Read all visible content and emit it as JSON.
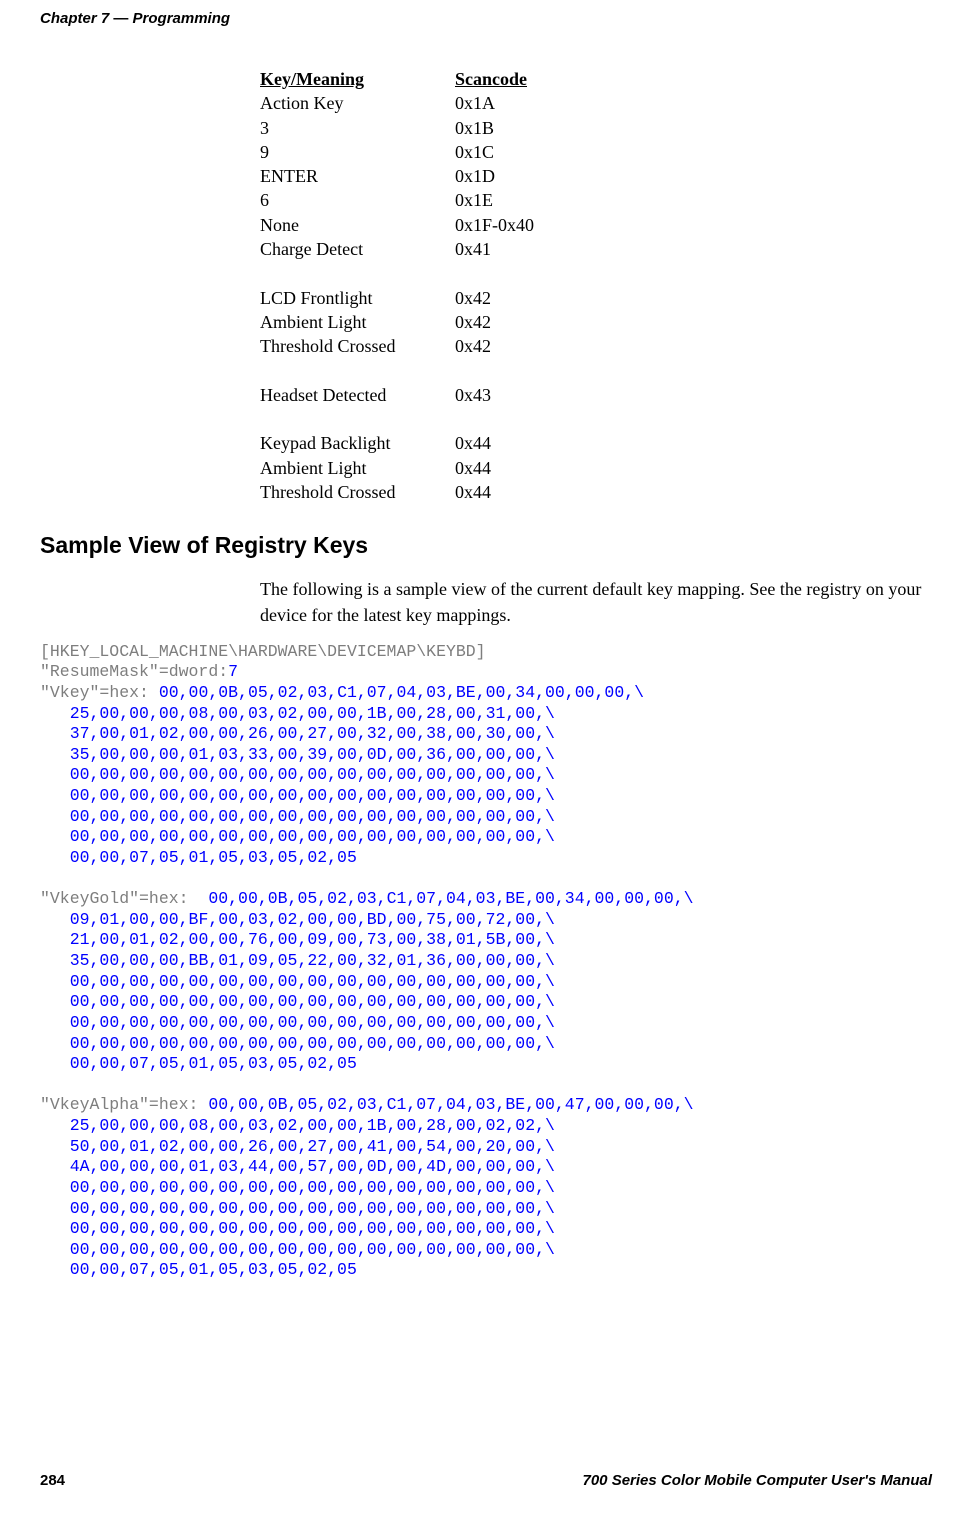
{
  "header": {
    "chapter": "Chapter 7",
    "sep": "—",
    "title": "Programming"
  },
  "scancode_table": {
    "head": {
      "key": "Key/Meaning",
      "scan": "Scancode"
    },
    "group1": [
      {
        "key": "Action Key",
        "scan": "0x1A"
      },
      {
        "key": "3",
        "scan": "0x1B"
      },
      {
        "key": "9",
        "scan": "0x1C"
      },
      {
        "key": "ENTER",
        "scan": "0x1D"
      },
      {
        "key": "6",
        "scan": "0x1E"
      },
      {
        "key": "None",
        "scan": "0x1F-0x40"
      },
      {
        "key": "Charge Detect",
        "scan": "0x41"
      }
    ],
    "group2": [
      {
        "key": "LCD Frontlight",
        "scan": "0x42"
      },
      {
        "key": "Ambient Light",
        "scan": "0x42"
      },
      {
        "key": "Threshold Crossed",
        "scan": "0x42"
      }
    ],
    "group3": [
      {
        "key": "Headset Detected",
        "scan": "0x43"
      }
    ],
    "group4": [
      {
        "key": "Keypad Backlight",
        "scan": "0x44"
      },
      {
        "key": "Ambient Light",
        "scan": "0x44"
      },
      {
        "key": "Threshold Crossed",
        "scan": "0x44"
      }
    ]
  },
  "section": {
    "heading": "Sample View of Registry Keys",
    "paragraph": "The following is a sample view of the current default key mapping. See the registry on your device for the latest key mappings."
  },
  "registry": {
    "path": "[HKEY_LOCAL_MACHINE\\HARDWARE\\DEVICEMAP\\KEYBD]",
    "resume": {
      "name": "\"ResumeMask\"",
      "eq": "=dword:",
      "val": "7"
    },
    "vkey": {
      "name": "\"Vkey\"",
      "eq": "=hex: ",
      "lines": [
        "00,00,0B,05,02,03,C1,07,04,03,BE,00,34,00,00,00,\\",
        "25,00,00,00,08,00,03,02,00,00,1B,00,28,00,31,00,\\",
        "37,00,01,02,00,00,26,00,27,00,32,00,38,00,30,00,\\",
        "35,00,00,00,01,03,33,00,39,00,0D,00,36,00,00,00,\\",
        "00,00,00,00,00,00,00,00,00,00,00,00,00,00,00,00,\\",
        "00,00,00,00,00,00,00,00,00,00,00,00,00,00,00,00,\\",
        "00,00,00,00,00,00,00,00,00,00,00,00,00,00,00,00,\\",
        "00,00,00,00,00,00,00,00,00,00,00,00,00,00,00,00,\\",
        "00,00,07,05,01,05,03,05,02,05"
      ]
    },
    "vkeygold": {
      "name": "\"VkeyGold\"",
      "eq": "=hex:  ",
      "lines": [
        "00,00,0B,05,02,03,C1,07,04,03,BE,00,34,00,00,00,\\",
        "09,01,00,00,BF,00,03,02,00,00,BD,00,75,00,72,00,\\",
        "21,00,01,02,00,00,76,00,09,00,73,00,38,01,5B,00,\\",
        "35,00,00,00,BB,01,09,05,22,00,32,01,36,00,00,00,\\",
        "00,00,00,00,00,00,00,00,00,00,00,00,00,00,00,00,\\",
        "00,00,00,00,00,00,00,00,00,00,00,00,00,00,00,00,\\",
        "00,00,00,00,00,00,00,00,00,00,00,00,00,00,00,00,\\",
        "00,00,00,00,00,00,00,00,00,00,00,00,00,00,00,00,\\",
        "00,00,07,05,01,05,03,05,02,05"
      ]
    },
    "vkeyalpha": {
      "name": "\"VkeyAlpha\"",
      "eq": "=hex: ",
      "lines": [
        "00,00,0B,05,02,03,C1,07,04,03,BE,00,47,00,00,00,\\",
        "25,00,00,00,08,00,03,02,00,00,1B,00,28,00,02,02,\\",
        "50,00,01,02,00,00,26,00,27,00,41,00,54,00,20,00,\\",
        "4A,00,00,00,01,03,44,00,57,00,0D,00,4D,00,00,00,\\",
        "00,00,00,00,00,00,00,00,00,00,00,00,00,00,00,00,\\",
        "00,00,00,00,00,00,00,00,00,00,00,00,00,00,00,00,\\",
        "00,00,00,00,00,00,00,00,00,00,00,00,00,00,00,00,\\",
        "00,00,00,00,00,00,00,00,00,00,00,00,00,00,00,00,\\",
        "00,00,07,05,01,05,03,05,02,05"
      ]
    }
  },
  "footer": {
    "page": "284",
    "title": "700 Series Color Mobile Computer User's Manual"
  }
}
